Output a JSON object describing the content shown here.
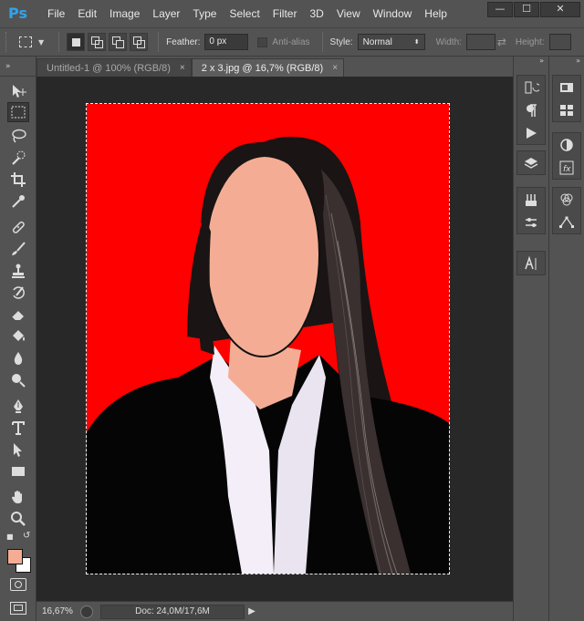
{
  "app": {
    "logo": "Ps",
    "menu": [
      "File",
      "Edit",
      "Image",
      "Layer",
      "Type",
      "Select",
      "Filter",
      "3D",
      "View",
      "Window",
      "Help"
    ],
    "window_controls": {
      "minimize": "—",
      "maximize": "☐",
      "close": "✕"
    }
  },
  "options_bar": {
    "feather_label": "Feather:",
    "feather_value": "0 px",
    "antialias_label": "Anti-alias",
    "style_label": "Style:",
    "style_value": "Normal",
    "width_label": "Width:",
    "height_label": "Height:"
  },
  "tabs": [
    {
      "label": "Untitled-1 @ 100% (RGB/8)",
      "close": "×",
      "active": false
    },
    {
      "label": "2 x 3.jpg @ 16,7% (RGB/8)",
      "close": "×",
      "active": true
    }
  ],
  "status": {
    "zoom": "16,67%",
    "doc_info": "Doc: 24,0M/17,6M",
    "arrow": "▶"
  },
  "colors": {
    "foreground": "#f4ad94",
    "background": "#ffffff",
    "canvas_bg": "#ff0000"
  },
  "tools": [
    "move-icon",
    "marquee-icon",
    "lasso-icon",
    "quick-select-icon",
    "crop-icon",
    "eyedropper-icon",
    "healing-icon",
    "brush-icon",
    "stamp-icon",
    "history-brush-icon",
    "eraser-icon",
    "bucket-icon",
    "blur-icon",
    "dodge-icon",
    "pen-icon",
    "type-icon",
    "path-select-icon",
    "shape-icon",
    "hand-icon",
    "zoom-icon"
  ],
  "panel_collapse": "»"
}
